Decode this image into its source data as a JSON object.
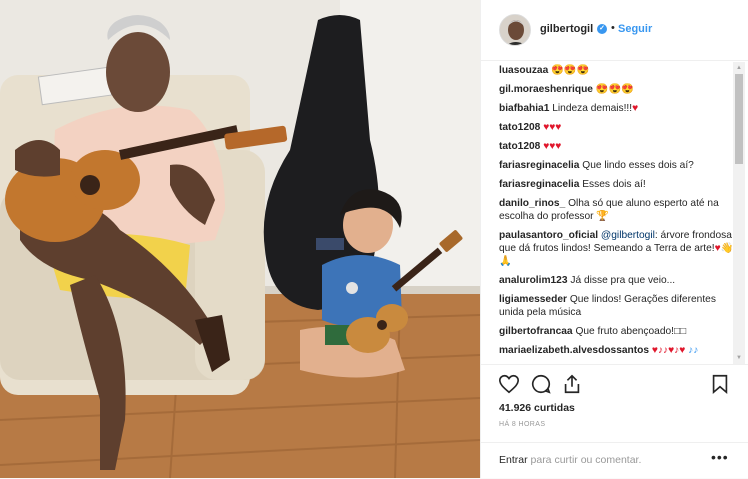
{
  "header": {
    "username": "gilbertogil",
    "verified_mark": "✓",
    "separator": "•",
    "follow_label": "Seguir"
  },
  "comments": [
    {
      "user": "luasouzaa",
      "text": "",
      "emoji": "😍😍😍"
    },
    {
      "user": "gil.moraeshenrique",
      "text": "",
      "emoji": "😍😍😍"
    },
    {
      "user": "biafbahia1",
      "text": "Lindeza demais!!!",
      "hearts": "♥"
    },
    {
      "user": "tato1208",
      "text": "",
      "hearts": "♥♥♥"
    },
    {
      "user": "tato1208",
      "text": "",
      "hearts": "♥♥♥"
    },
    {
      "user": "fariasreginacelia",
      "text": "Que lindo esses dois aí?"
    },
    {
      "user": "fariasreginacelia",
      "text": "Esses dois aí!"
    },
    {
      "user": "danilo_rinos_",
      "text": "Olha só que aluno esperto até na escolha do professor",
      "emoji": "🏆"
    },
    {
      "user": "paulasantoro_oficial",
      "mention": "@gilbertogil",
      "text": ": árvore frondosa que dá frutos lindos! Semeando a Terra de arte!",
      "hearts": "♥",
      "emoji": "👋🙏"
    },
    {
      "user": "analurolim123",
      "text": "Já disse pra que veio..."
    },
    {
      "user": "ligiamesseder",
      "text": "Que lindos! Gerações diferentes unida pela música"
    },
    {
      "user": "gilbertofrancaa",
      "text": "Que fruto abençoado!",
      "emoji": "□□"
    },
    {
      "user": "mariaelizabeth.alvesdossantos",
      "text": "",
      "hearts": "♥♪♪♥♪♥",
      "notes": "♪♪"
    }
  ],
  "actions": {
    "like_icon": "heart-outline-icon",
    "comment_icon": "comment-bubble-icon",
    "share_icon": "share-icon",
    "save_icon": "bookmark-icon"
  },
  "likes": "41.926 curtidas",
  "timestamp": "HÁ 8 HORAS",
  "add_comment": {
    "login_link": "Entrar",
    "login_text": " para curtir ou comentar.",
    "more_label": "•••"
  },
  "colors": {
    "accent": "#3897f0",
    "heart": "#e0162b",
    "text": "#262626",
    "muted": "#999999",
    "border": "#efefef"
  }
}
